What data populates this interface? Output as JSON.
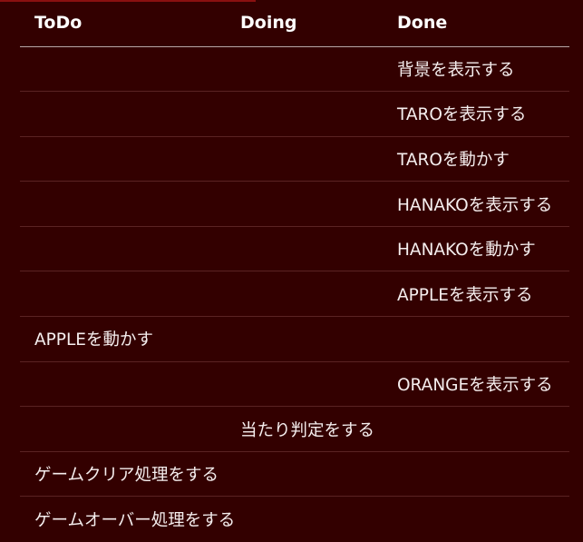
{
  "board": {
    "columns": [
      "ToDo",
      "Doing",
      "Done"
    ],
    "rows": [
      {
        "todo": "",
        "doing": "",
        "done": "背景を表示する"
      },
      {
        "todo": "",
        "doing": "",
        "done": "TAROを表示する"
      },
      {
        "todo": "",
        "doing": "",
        "done": "TAROを動かす"
      },
      {
        "todo": "",
        "doing": "",
        "done": "HANAKOを表示する"
      },
      {
        "todo": "",
        "doing": "",
        "done": "HANAKOを動かす"
      },
      {
        "todo": "",
        "doing": "",
        "done": "APPLEを表示する"
      },
      {
        "todo": "APPLEを動かす",
        "doing": "",
        "done": ""
      },
      {
        "todo": "",
        "doing": "",
        "done": "ORANGEを表示する"
      },
      {
        "todo": "",
        "doing": "当たり判定をする",
        "done": ""
      },
      {
        "todo": "ゲームクリア処理をする",
        "doing": "",
        "done": ""
      },
      {
        "todo": "ゲームオーバー処理をする",
        "doing": "",
        "done": ""
      }
    ]
  },
  "colors": {
    "background": "#330000",
    "text": "#f5eeee",
    "header_divider": "#b8a6a6",
    "row_divider": "#5a2323",
    "top_accent": "#8a1010"
  }
}
